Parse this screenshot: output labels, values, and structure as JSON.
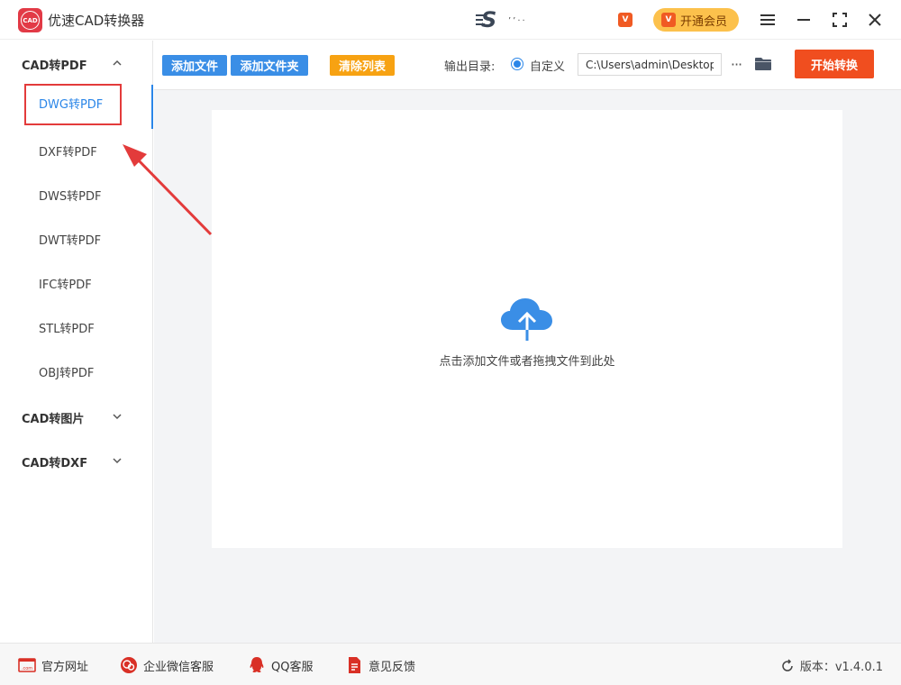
{
  "window": {
    "title": "优速CAD转换器",
    "logo_text": "CAD",
    "vip_small_text": "V",
    "vip_button_label": "开通会员",
    "user_name": "’’··"
  },
  "sidebar": {
    "groups": [
      {
        "label": "CAD转PDF",
        "expanded": true
      },
      {
        "label": "CAD转图片",
        "expanded": false
      },
      {
        "label": "CAD转DXF",
        "expanded": false
      }
    ],
    "items": [
      {
        "label": "DWG转PDF",
        "active": true
      },
      {
        "label": "DXF转PDF",
        "active": false
      },
      {
        "label": "DWS转PDF",
        "active": false
      },
      {
        "label": "DWT转PDF",
        "active": false
      },
      {
        "label": "IFC转PDF",
        "active": false
      },
      {
        "label": "STL转PDF",
        "active": false
      },
      {
        "label": "OBJ转PDF",
        "active": false
      }
    ]
  },
  "toolbar": {
    "add_file": "添加文件",
    "add_folder": "添加文件夹",
    "clear_list": "清除列表",
    "output_label": "输出目录:",
    "custom_label": "自定义",
    "output_path": "C:\\Users\\admin\\Desktop",
    "more_label": "···",
    "start_label": "开始转换"
  },
  "dropzone": {
    "hint": "点击添加文件或者拖拽文件到此处"
  },
  "footer": {
    "website": "官方网址",
    "wechat": "企业微信客服",
    "qq": "QQ客服",
    "feedback": "意见反馈",
    "version": "版本：v1.4.0.1"
  },
  "colors": {
    "accent_blue": "#3a8ee6",
    "orange": "#f7a212",
    "start_red": "#f04e1f",
    "vip_gold": "#fcc14c",
    "annotation_red": "#e33b3b"
  }
}
